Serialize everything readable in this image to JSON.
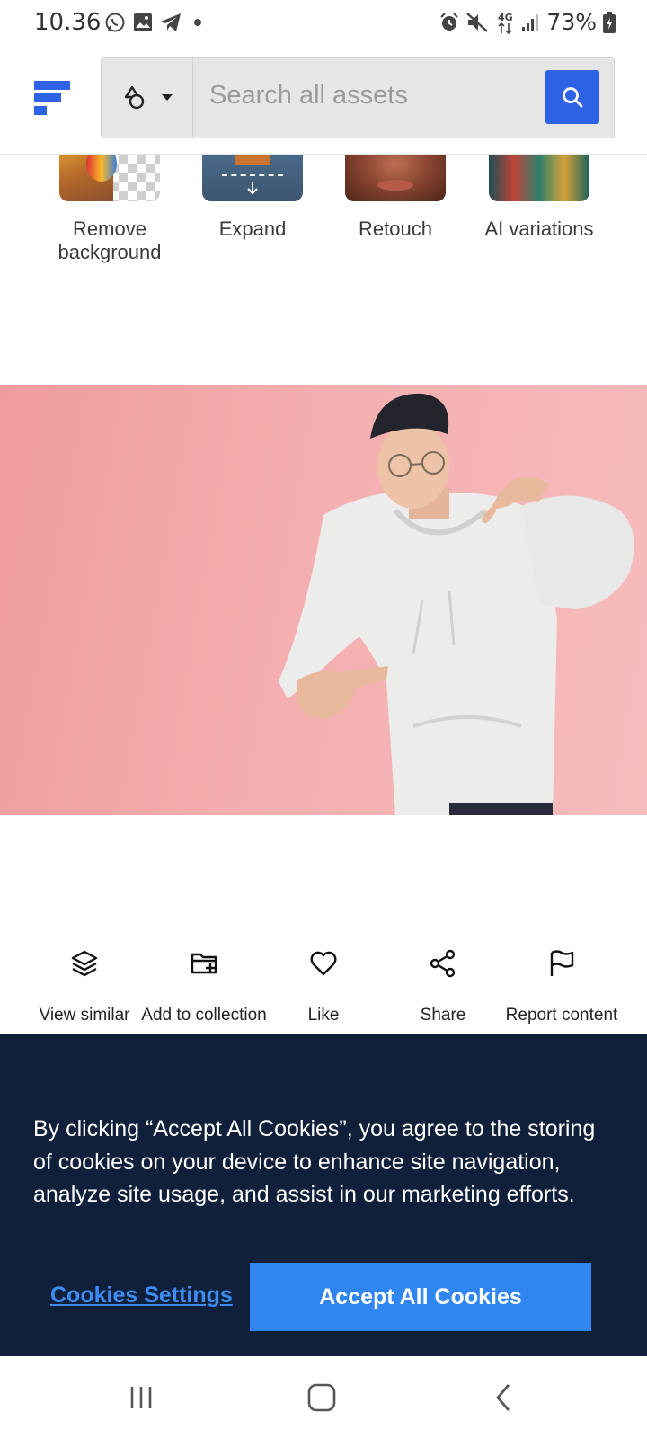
{
  "status_bar": {
    "time": "10.36",
    "battery": "73%",
    "left_icons": [
      "whatsapp-icon",
      "gallery-icon",
      "telegram-icon",
      "dot-icon"
    ],
    "right_icons": [
      "alarm-icon",
      "mute-icon",
      "4g-icon",
      "signal-icon",
      "battery-icon"
    ]
  },
  "header": {
    "search_placeholder": "Search all assets",
    "asset_type_icon": "shapes-icon",
    "accent_color": "#2e63e6"
  },
  "tools": [
    {
      "label": "Remove background"
    },
    {
      "label": "Expand"
    },
    {
      "label": "Retouch"
    },
    {
      "label": "AI variations"
    }
  ],
  "actions": [
    {
      "label": "View similar",
      "icon": "layers-icon"
    },
    {
      "label": "Add to collection",
      "icon": "folder-plus-icon"
    },
    {
      "label": "Like",
      "icon": "heart-icon"
    },
    {
      "label": "Share",
      "icon": "share-icon"
    },
    {
      "label": "Report content",
      "icon": "flag-icon"
    }
  ],
  "cookie_banner": {
    "text": "By clicking “Accept All Cookies”, you agree to the storing of cookies on your device to enhance site navigation, analyze site usage, and assist in our marketing efforts.",
    "settings_label": "Cookies Settings",
    "accept_label": "Accept All Cookies",
    "background_color": "#10203a",
    "button_color": "#2f86f0"
  },
  "nav_bar": {
    "buttons": [
      "recents-icon",
      "home-icon",
      "back-icon"
    ]
  }
}
